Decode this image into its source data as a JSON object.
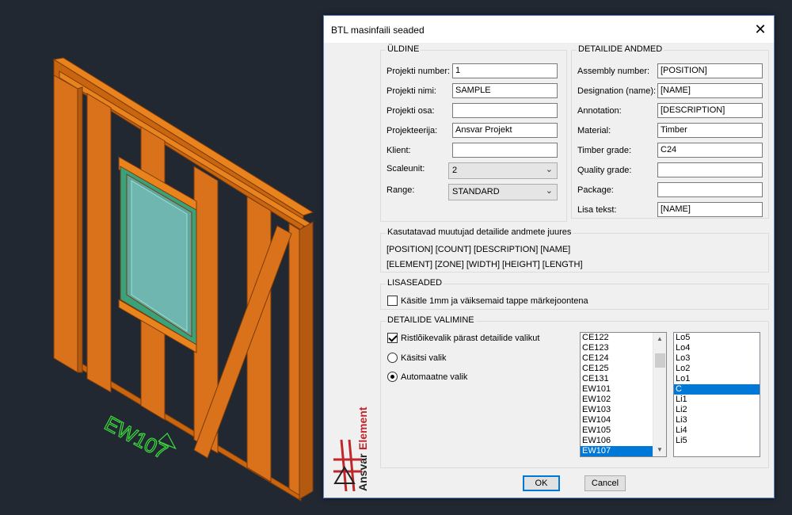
{
  "cad": {
    "element_label": "EW107"
  },
  "dialog": {
    "title": "BTL masinfaili seaded",
    "close_glyph": "✕",
    "logo": {
      "text_a": "Ansvar",
      "text_b": "Element"
    },
    "uldine": {
      "heading": "ÜLDINE",
      "fields": [
        {
          "label": "Projekti number:",
          "value": "1"
        },
        {
          "label": "Projekti nimi:",
          "value": "SAMPLE"
        },
        {
          "label": "Projekti osa:",
          "value": ""
        },
        {
          "label": "Projekteerija:",
          "value": "Ansvar Projekt"
        },
        {
          "label": "Klient:",
          "value": ""
        }
      ],
      "scaleunit": {
        "label": "Scaleunit:",
        "value": "2"
      },
      "range": {
        "label": "Range:",
        "value": "STANDARD"
      }
    },
    "detailide_andmed": {
      "heading": "DETAILIDE ANDMED",
      "fields": [
        {
          "label": "Assembly number:",
          "value": "[POSITION]"
        },
        {
          "label": "Designation (name):",
          "value": "[NAME]"
        },
        {
          "label": "Annotation:",
          "value": "[DESCRIPTION]"
        },
        {
          "label": "Material:",
          "value": "Timber"
        },
        {
          "label": "Timber grade:",
          "value": "C24"
        },
        {
          "label": "Quality grade:",
          "value": ""
        },
        {
          "label": "Package:",
          "value": ""
        },
        {
          "label": "Lisa tekst:",
          "value": "[NAME]"
        }
      ]
    },
    "variables": {
      "heading": "Kasutatavad muutujad detailide andmete juures",
      "line1": "[POSITION] [COUNT] [DESCRIPTION] [NAME]",
      "line2": "[ELEMENT] [ZONE] [WIDTH] [HEIGHT] [LENGTH]"
    },
    "lisaseaded": {
      "heading": "LISASEADED",
      "checkbox_label": "Käsitle 1mm ja väiksemaid tappe märkejoontena",
      "checked": false
    },
    "valimine": {
      "heading": "DETAILIDE VALIMINE",
      "checkbox_label": "Ristlõikevalik pärast detailide valikut",
      "checkbox_checked": true,
      "radio_manual": "Käsitsi valik",
      "radio_auto": "Automaatne valik",
      "selected_radio": "auto",
      "list_left": [
        "CE122",
        "CE123",
        "CE124",
        "CE125",
        "CE131",
        "EW101",
        "EW102",
        "EW103",
        "EW104",
        "EW105",
        "EW106",
        "EW107"
      ],
      "list_left_selected": "EW107",
      "list_right": [
        "Lo5",
        "Lo4",
        "Lo3",
        "Lo2",
        "Lo1",
        "C",
        "Li1",
        "Li2",
        "Li3",
        "Li4",
        "Li5"
      ],
      "list_right_selected": "C"
    },
    "buttons": {
      "ok": "OK",
      "cancel": "Cancel"
    }
  }
}
